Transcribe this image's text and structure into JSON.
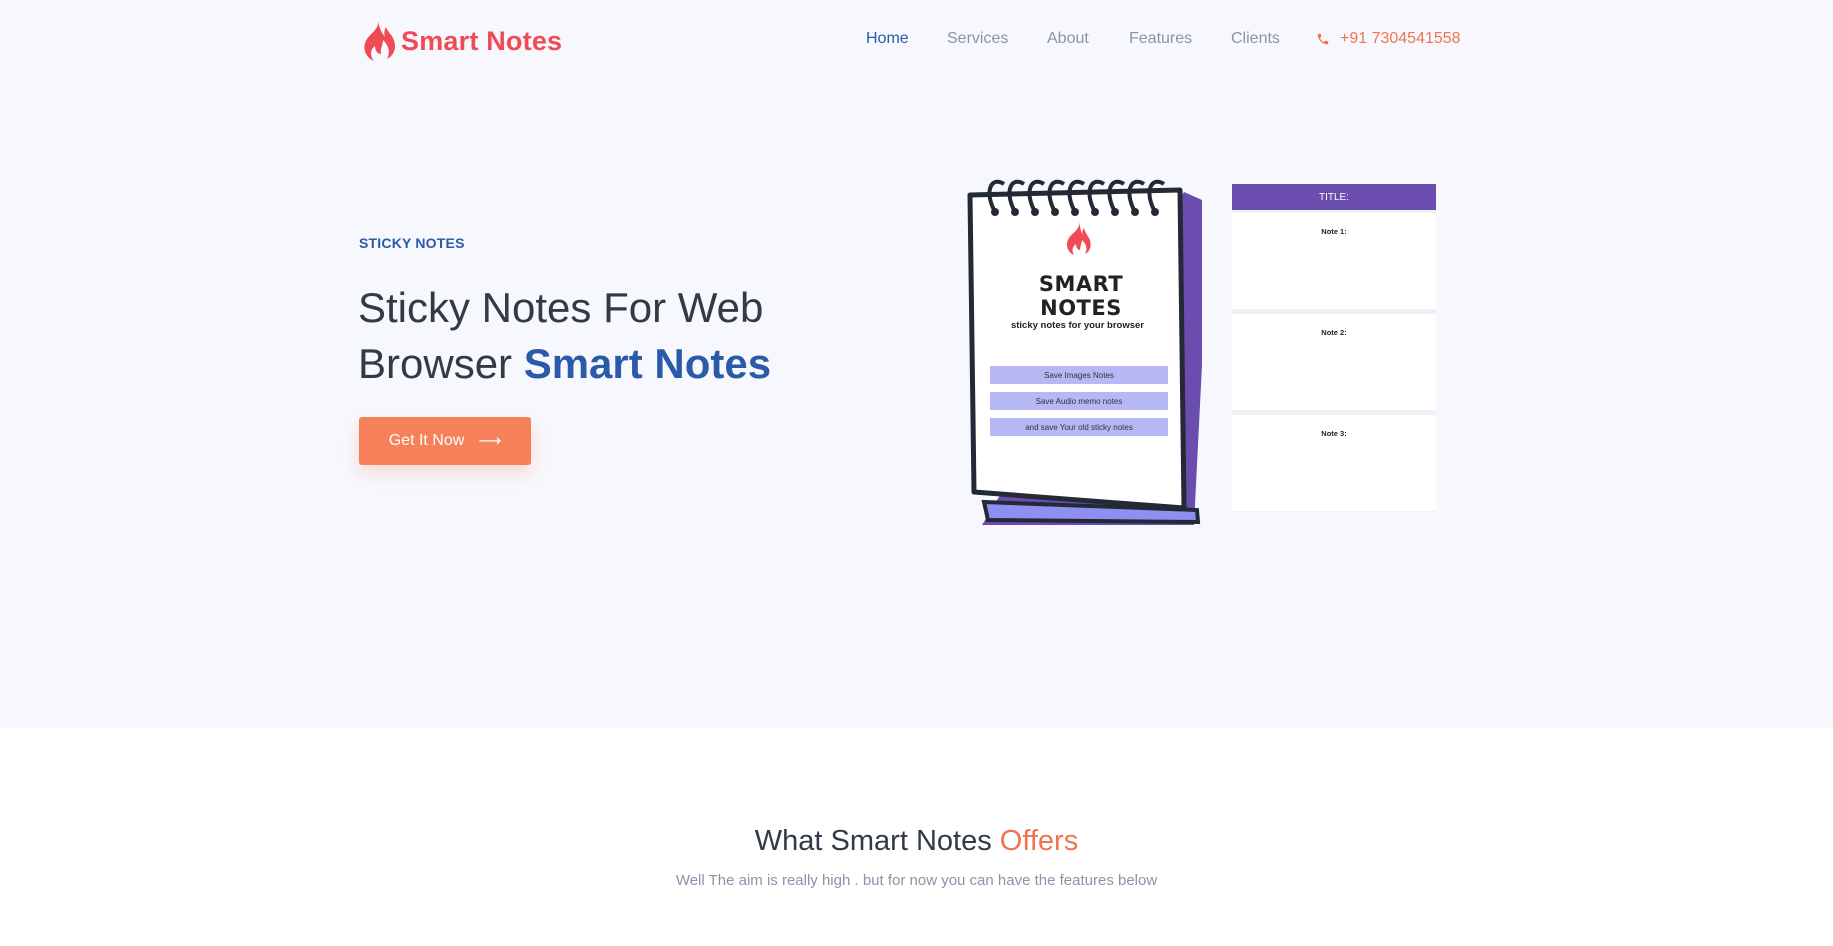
{
  "brand": {
    "name": "Smart Notes",
    "color": "#ef4a55"
  },
  "nav": {
    "items": [
      {
        "label": "Home",
        "active": true
      },
      {
        "label": "Services"
      },
      {
        "label": "About"
      },
      {
        "label": "Features"
      },
      {
        "label": "Clients"
      }
    ],
    "phone": "+91 7304541558"
  },
  "hero": {
    "eyebrow": "STICKY NOTES",
    "headline_part1": "Sticky Notes For Web",
    "headline_part2": "Browser ",
    "headline_accent": "Smart Notes",
    "cta_label": "Get It Now",
    "cta_arrow": "⟶"
  },
  "illustration": {
    "pad_title": "SMART NOTES",
    "pad_subtitle": "sticky notes for your browser",
    "pad_buttons": [
      "Save Images Notes",
      "Save Audio memo notes",
      "and save Your old sticky notes"
    ],
    "card_title": "TITLE:",
    "notes": [
      "Note 1:",
      "Note 2:",
      "Note 3:"
    ]
  },
  "offers": {
    "title_part1": "What Smart Notes ",
    "title_accent": "Offers",
    "subtitle": "Well The aim is really high . but for now you can have the features below"
  },
  "colors": {
    "accent_blue": "#2a5aa8",
    "accent_orange": "#f1744f",
    "cta": "#f5805a",
    "card_header": "#6b4db0"
  }
}
